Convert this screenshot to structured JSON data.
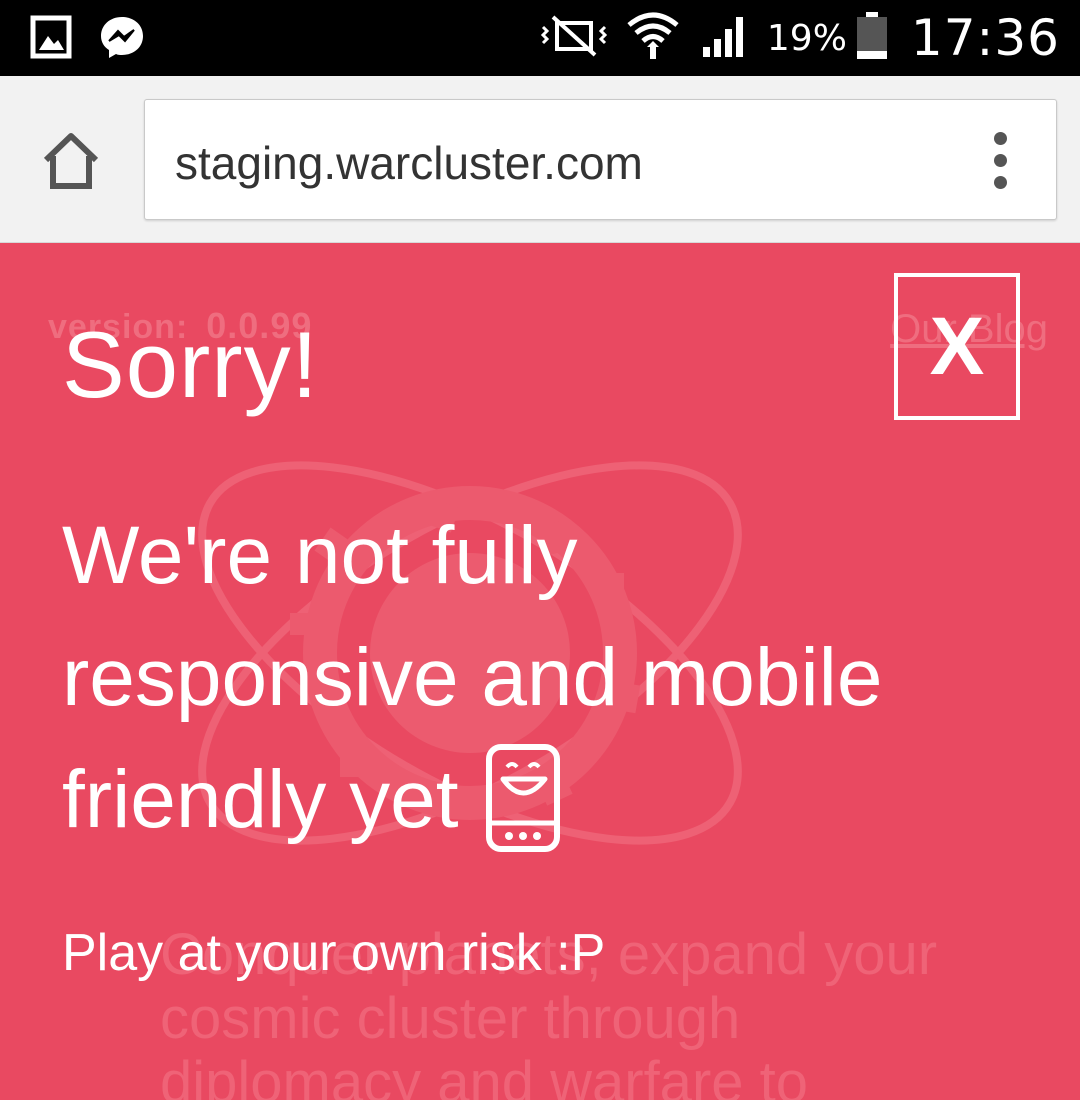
{
  "status_bar": {
    "icons_left": [
      "gallery-icon",
      "messenger-icon"
    ],
    "icons_right": [
      "mute-icon",
      "wifi-icon",
      "signal-icon"
    ],
    "battery": "19%",
    "time": "17:36"
  },
  "browser": {
    "url": "staging.warcluster.com",
    "home_icon": "home-icon",
    "menu_icon": "overflow-menu-icon"
  },
  "background_site": {
    "version_label": "version:",
    "version_number": "0.0.99",
    "blog_link": "Our Blog",
    "tagline_lines": [
      "Conquer planets, expand your",
      "cosmic cluster through",
      "diplomacy and warfare to"
    ]
  },
  "overlay": {
    "title": "Sorry!",
    "close_label": "X",
    "message_line1": "We're not fully",
    "message_line2": "responsive and mobile",
    "message_line3": "friendly yet",
    "risk_text": "Play at your own risk :P",
    "emoji_icon": "smiling-phone-icon"
  },
  "colors": {
    "overlay_bg": "#e94961",
    "status_bar_bg": "#000000",
    "browser_bar_bg": "#f2f2f2"
  }
}
